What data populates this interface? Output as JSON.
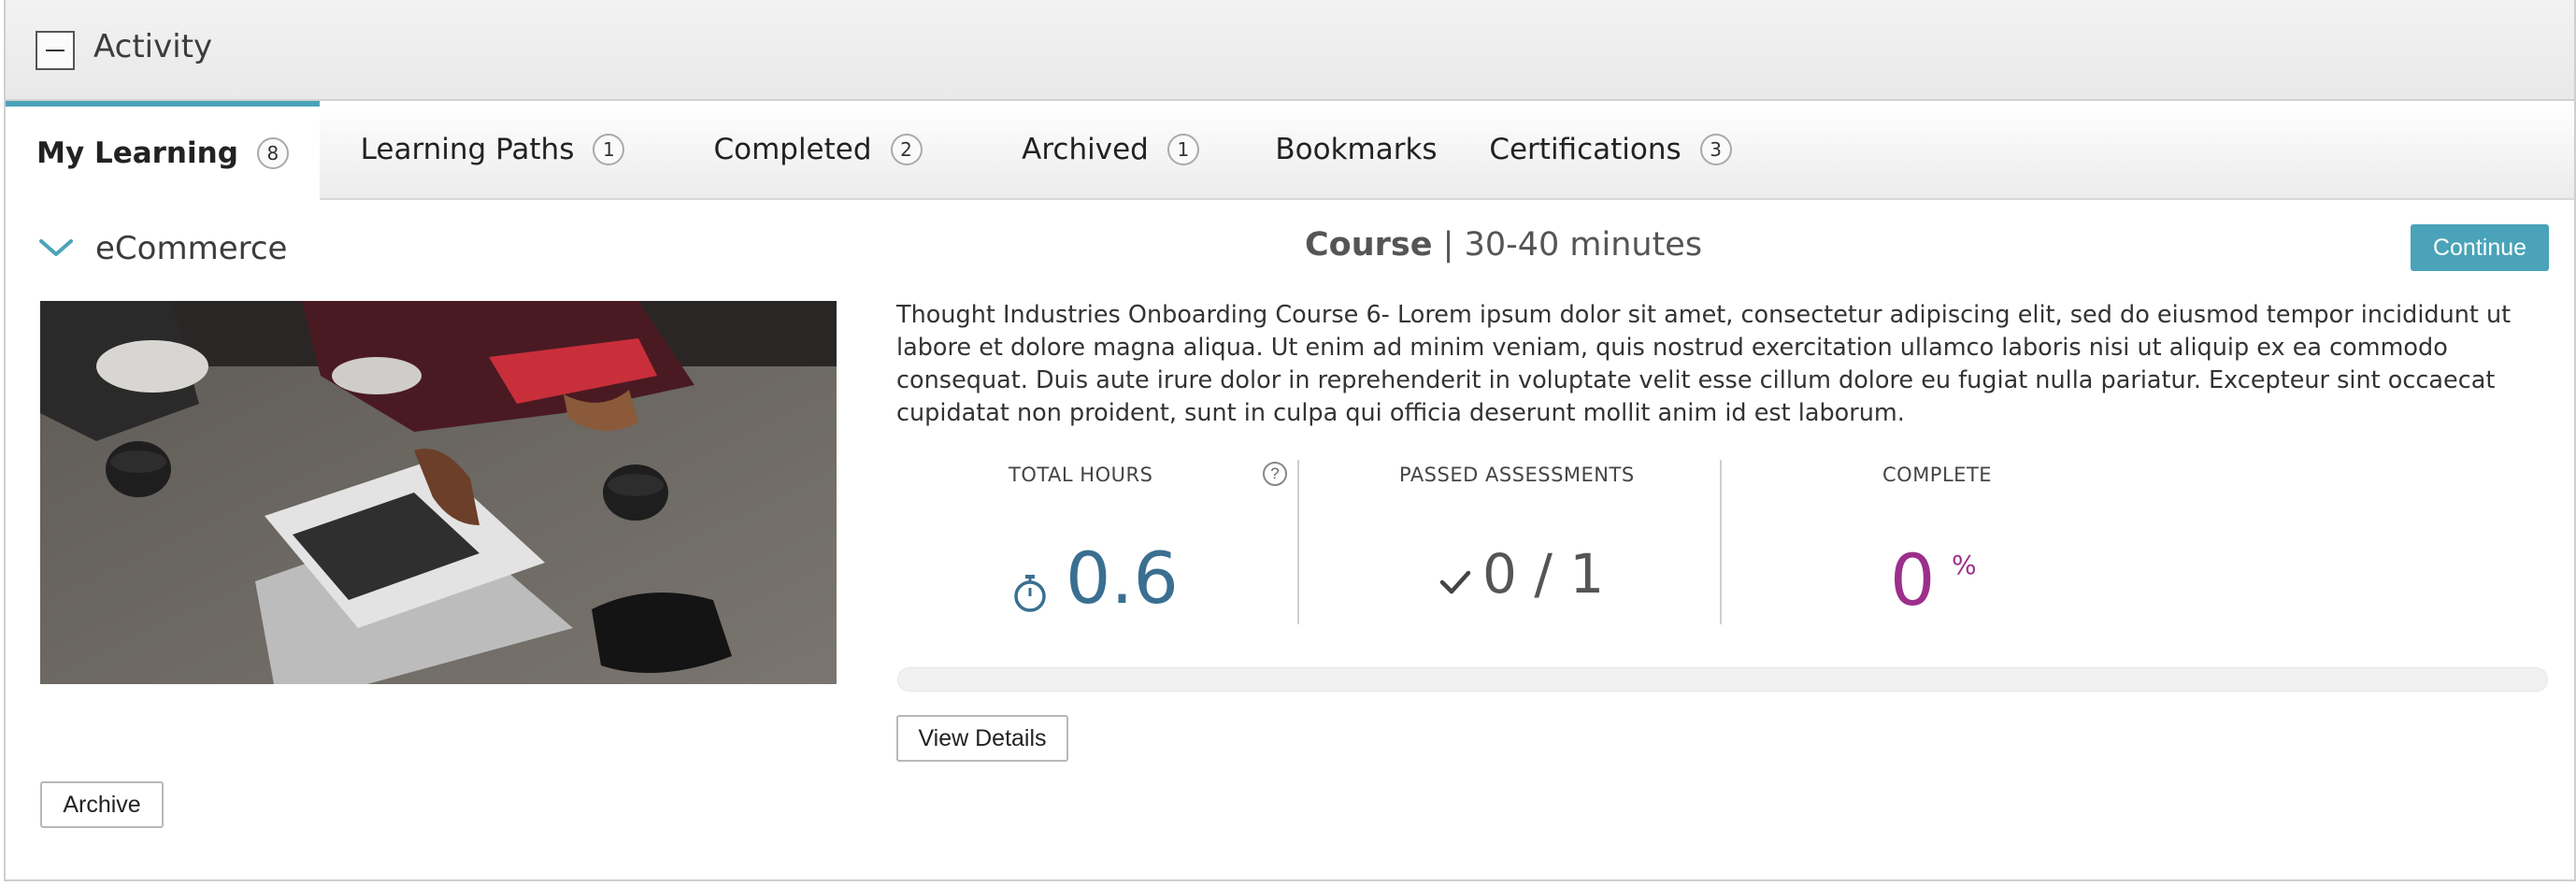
{
  "header": {
    "title": "Activity"
  },
  "tabs": [
    {
      "label": "My Learning",
      "count": "8"
    },
    {
      "label": "Learning Paths",
      "count": "1"
    },
    {
      "label": "Completed",
      "count": "2"
    },
    {
      "label": "Archived",
      "count": "1"
    },
    {
      "label": "Bookmarks"
    },
    {
      "label": "Certifications",
      "count": "3"
    }
  ],
  "course": {
    "name": "eCommerce",
    "type": "Course",
    "separator": "|",
    "duration": "30-40 minutes",
    "continue_label": "Continue",
    "description": "Thought Industries Onboarding Course 6- Lorem ipsum dolor sit amet, consectetur adipiscing elit, sed do eiusmod tempor incididunt ut labore et dolore magna aliqua. Ut enim ad minim veniam, quis nostrud exercitation ullamco laboris nisi ut aliquip ex ea commodo consequat. Duis aute irure dolor in reprehenderit in voluptate velit esse cillum dolore eu fugiat nulla pariatur. Excepteur sint occaecat cupidatat non proident, sunt in culpa qui officia deserunt mollit anim id est laborum.",
    "image_icon": "photo-laptop-coffee-icon"
  },
  "stats": {
    "total_hours_label": "TOTAL HOURS",
    "total_hours_value": "0.6",
    "help_glyph": "?",
    "passed_label": "PASSED ASSESSMENTS",
    "passed_value": "0 / 1",
    "complete_label": "COMPLETE",
    "complete_value": "0",
    "complete_unit": "%"
  },
  "progress": {
    "fraction": 0
  },
  "buttons": {
    "view_details": "View Details",
    "archive": "Archive"
  },
  "colors": {
    "accent": "#4aa3b8",
    "hours": "#3a6f91",
    "complete": "#9c2f8c"
  }
}
